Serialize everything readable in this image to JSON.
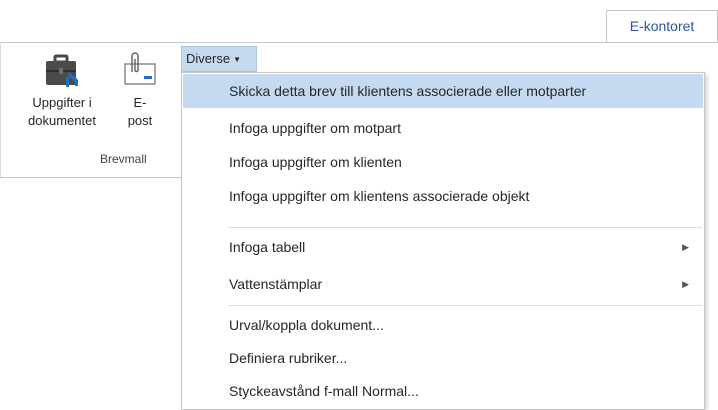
{
  "tabs": {
    "active_label": "E-kontoret"
  },
  "ribbon": {
    "uppgifter_label_line1": "Uppgifter i",
    "uppgifter_label_line2": "dokumentet",
    "epost_label_line1": "E-",
    "epost_label_line2": "post",
    "group_label": "Brevmall",
    "diverse_label": "Diverse"
  },
  "menu": {
    "items": [
      {
        "label": "Skicka detta brev till klientens associerade eller motparter"
      },
      {
        "label": "Infoga uppgifter om motpart"
      },
      {
        "label": "Infoga uppgifter om klienten"
      },
      {
        "label": "Infoga uppgifter om klientens associerade objekt"
      },
      {
        "label": "Infoga tabell"
      },
      {
        "label": "Vattenstämplar"
      },
      {
        "label": "Urval/koppla dokument..."
      },
      {
        "label": "Definiera rubriker..."
      },
      {
        "label": "Styckeavstånd f-mall Normal..."
      }
    ]
  },
  "colors": {
    "accent": "#2b579a",
    "hover": "#c5daf0"
  },
  "icons": [
    "briefcase-tools-icon",
    "paperclip-mail-icon",
    "caret-down-icon",
    "submenu-arrow-icon"
  ]
}
